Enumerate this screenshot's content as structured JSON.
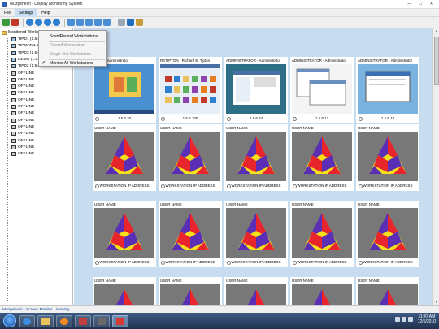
{
  "window": {
    "title": "Muzpeheim - Display Monitoring System",
    "controls": [
      "–",
      "□",
      "✕"
    ]
  },
  "menubar": [
    {
      "label": "File"
    },
    {
      "label": "Settings"
    },
    {
      "label": "Help"
    }
  ],
  "toolbar": {
    "buttons": [
      {
        "icon": "connect-icon",
        "color": "#3a9a3a"
      },
      {
        "icon": "disconnect-icon",
        "color": "#c0392b"
      },
      {
        "icon": "globe-icon",
        "color": "#2f7fd0"
      },
      {
        "icon": "globe-icon",
        "color": "#2f7fd0"
      },
      {
        "icon": "globe-icon",
        "color": "#2f7fd0"
      },
      {
        "icon": "globe-icon",
        "color": "#2f7fd0"
      },
      {
        "icon": "shield-icon",
        "color": "#4a8fd8"
      },
      {
        "icon": "shield-icon",
        "color": "#4a8fd8"
      },
      {
        "icon": "shield-icon",
        "color": "#4a8fd8"
      },
      {
        "icon": "shield-icon",
        "color": "#4a8fd8"
      },
      {
        "icon": "shield-icon",
        "color": "#4a8fd8"
      },
      {
        "icon": "printer-icon",
        "color": "#9aa7b5"
      },
      {
        "icon": "settings-icon",
        "color": "#1e6fc4"
      },
      {
        "icon": "users-icon",
        "color": "#c99a3a"
      }
    ]
  },
  "dropdown": {
    "items": [
      {
        "label": "Scan/Record Workstations",
        "disabled": false,
        "checked": false
      },
      {
        "label": "Record Workstation",
        "disabled": true,
        "checked": false
      },
      {
        "label": "Single Out Workstation",
        "disabled": true,
        "checked": false
      },
      {
        "label": "Monitor All Workstations",
        "disabled": false,
        "checked": true
      }
    ]
  },
  "tree": {
    "root": "Monitored Workstations",
    "items": [
      {
        "label": "TIPD1 (1.5.6.20)",
        "online": true
      },
      {
        "label": "TIPMAT(1.5.6.100)",
        "online": true
      },
      {
        "label": "TIPD3 (1.5.6.24)",
        "online": true
      },
      {
        "label": "DEMO (1.5.6.12)",
        "online": true
      },
      {
        "label": "TIPD2 (1.5.6.13)",
        "online": true
      },
      {
        "label": "OFFLINE",
        "online": false
      },
      {
        "label": "OFFLINE",
        "online": false
      },
      {
        "label": "OFFLINE",
        "online": false
      },
      {
        "label": "OFFLINE",
        "online": false
      },
      {
        "label": "OFFLINE",
        "online": false
      },
      {
        "label": "OFFLINE",
        "online": false
      },
      {
        "label": "OFFLINE",
        "online": false
      },
      {
        "label": "OFFLINE",
        "online": false
      },
      {
        "label": "OFFLINE",
        "online": false
      },
      {
        "label": "OFFLINE",
        "online": false
      },
      {
        "label": "OFFLINE",
        "online": false
      },
      {
        "label": "OFFLINE",
        "online": false
      },
      {
        "label": "OFFLINE",
        "online": false
      }
    ]
  },
  "tiles": [
    [
      {
        "head": "ATOR - Administrator",
        "foot": "1.5.6.20",
        "screen": "desktop-blue"
      },
      {
        "head": "RETIPTON - Richard E. Tipton",
        "foot": "1.5.6.100",
        "screen": "desktop-apps"
      },
      {
        "head": "ADMINISTRATOR - Administrator",
        "foot": "1.5.6.24",
        "screen": "desktop-teal"
      },
      {
        "head": "ADMINISTRATOR - Administrator",
        "foot": "1.5.6.12",
        "screen": "desktop-window"
      },
      {
        "head": "ADMINISTRATOR - Administrator",
        "foot": "1.5.6.13",
        "screen": "desktop-sky"
      }
    ],
    [
      {
        "head": "USER NAME",
        "foot": "WORKSTATION IP ADDRESS",
        "screen": "logo"
      },
      {
        "head": "USER NAME",
        "foot": "WORKSTATION IP ADDRESS",
        "screen": "logo"
      },
      {
        "head": "USER NAME",
        "foot": "WORKSTATION IP ADDRESS",
        "screen": "logo"
      },
      {
        "head": "USER NAME",
        "foot": "WORKSTATION IP ADDRESS",
        "screen": "logo"
      },
      {
        "head": "USER NAME",
        "foot": "WORKSTATION IP ADDRESS",
        "screen": "logo"
      }
    ],
    [
      {
        "head": "USER NAME",
        "foot": "WORKSTATION IP ADDRESS",
        "screen": "logo"
      },
      {
        "head": "USER NAME",
        "foot": "WORKSTATION IP ADDRESS",
        "screen": "logo"
      },
      {
        "head": "USER NAME",
        "foot": "WORKSTATION IP ADDRESS",
        "screen": "logo"
      },
      {
        "head": "USER NAME",
        "foot": "WORKSTATION IP ADDRESS",
        "screen": "logo"
      },
      {
        "head": "USER NAME",
        "foot": "WORKSTATION IP ADDRESS",
        "screen": "logo"
      }
    ],
    [
      {
        "head": "USER NAME",
        "foot": "",
        "screen": "logo"
      },
      {
        "head": "USER NAME",
        "foot": "",
        "screen": "logo"
      },
      {
        "head": "USER NAME",
        "foot": "",
        "screen": "logo"
      },
      {
        "head": "USER NAME",
        "foot": "",
        "screen": "logo"
      },
      {
        "head": "USER NAME",
        "foot": "",
        "screen": "logo"
      }
    ]
  ],
  "statusbar": {
    "text": "Muzpeheim - Screen Monitor Listening..."
  },
  "taskbar": {
    "time": "11:47 AM",
    "date": "12/5/2010"
  },
  "colors": {
    "content_bg": "#c8dcf0",
    "logo_red": "#e8242c",
    "logo_yellow": "#f5e01a",
    "logo_purple": "#5b2fb5",
    "logo_bg": "#787878"
  }
}
